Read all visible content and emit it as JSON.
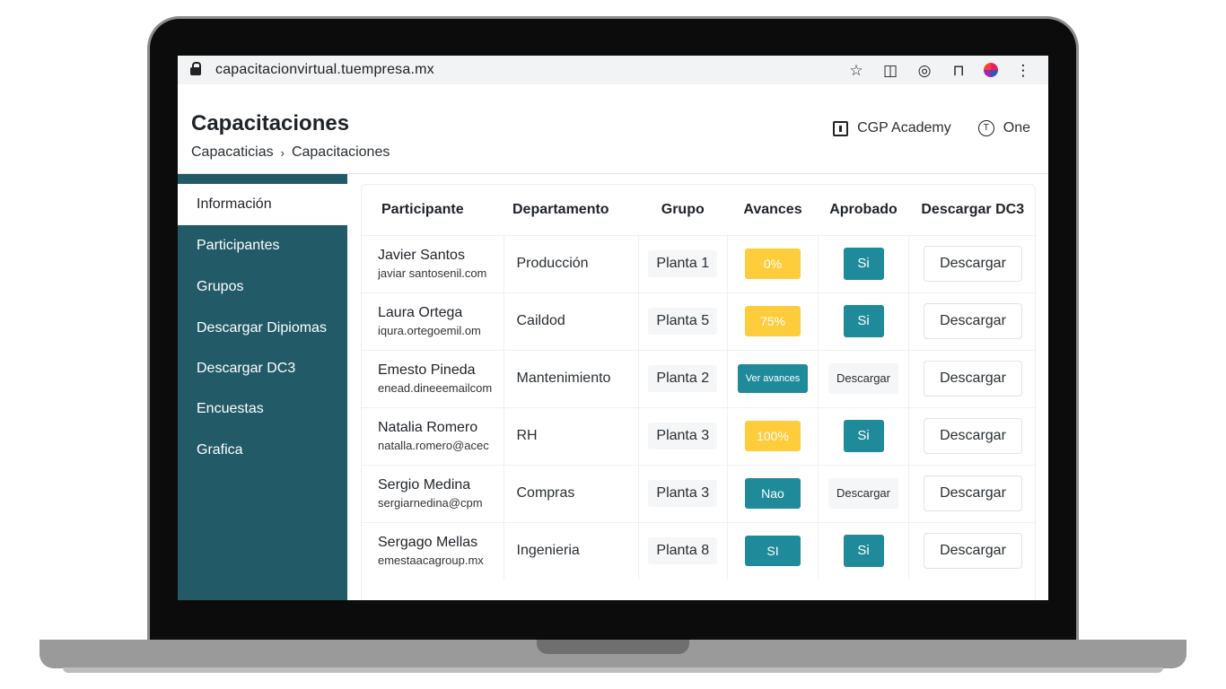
{
  "browser": {
    "url": "capacitacionvirtual.tuempresa.mx",
    "icons": [
      "lock-icon",
      "star-icon",
      "split-view-icon",
      "vpn-icon",
      "extension-icon",
      "profile-icon",
      "more-icon"
    ]
  },
  "header": {
    "title": "Capacitaciones",
    "breadcrumb": [
      "Capacaticias",
      "Capacitaciones"
    ],
    "organization": "CGP Academy",
    "user_initial": "T",
    "user_name": "One"
  },
  "sidebar": {
    "items": [
      {
        "label": "Información",
        "active": true
      },
      {
        "label": "Participantes"
      },
      {
        "label": "Grupos"
      },
      {
        "label": "Descargar Dipiomas"
      },
      {
        "label": "Descargar DC3"
      },
      {
        "label": "Encuestas"
      },
      {
        "label": "Grafica"
      }
    ]
  },
  "table": {
    "headers": [
      "Participante",
      "Departamento",
      "Grupo",
      "Avances",
      "Aprobado",
      "Descargar DC3"
    ],
    "rows": [
      {
        "name": "Javier Santos",
        "email": "javiar santosenil.com",
        "departamento": "Producción",
        "grupo": "Planta 1",
        "avances": "0%",
        "aprobado": "Si",
        "descargar": "Descargar"
      },
      {
        "name": "Laura Ortega",
        "email": "iqura.ortegoemil.om",
        "departamento": "Caildod",
        "grupo": "Planta 5",
        "avances": "75%",
        "aprobado": "Si",
        "descargar": "Descargar"
      },
      {
        "name": "Emesto Pineda",
        "email": "enead.dineeemailcom",
        "departamento": "Mantenimiento",
        "grupo": "Planta 2",
        "avances": "Ver avances",
        "aprobado": "Descargar",
        "descargar": "Descargar"
      },
      {
        "name": "Natalia Romero",
        "email": "natalla.romero@acec",
        "departamento": "RH",
        "grupo": "Planta 3",
        "avances": "100%",
        "aprobado": "Si",
        "descargar": "Descargar"
      },
      {
        "name": "Sergio Medina",
        "email": "sergiarnedina@cpm",
        "departamento": "Compras",
        "grupo": "Planta 3",
        "avances": "Nao",
        "aprobado": "Descargar",
        "descargar": "Descargar"
      },
      {
        "name": "Sergago Mellas",
        "email": "emestaacagroup.mx",
        "departamento": "Ingenieria",
        "grupo": "Planta 8",
        "avances": "SI",
        "aprobado": "Si",
        "descargar": "Descargar"
      }
    ]
  },
  "colors": {
    "sidebar": "#225a68",
    "accent_teal": "#1f8a9a",
    "progress_yellow": "#ffcd3c"
  }
}
